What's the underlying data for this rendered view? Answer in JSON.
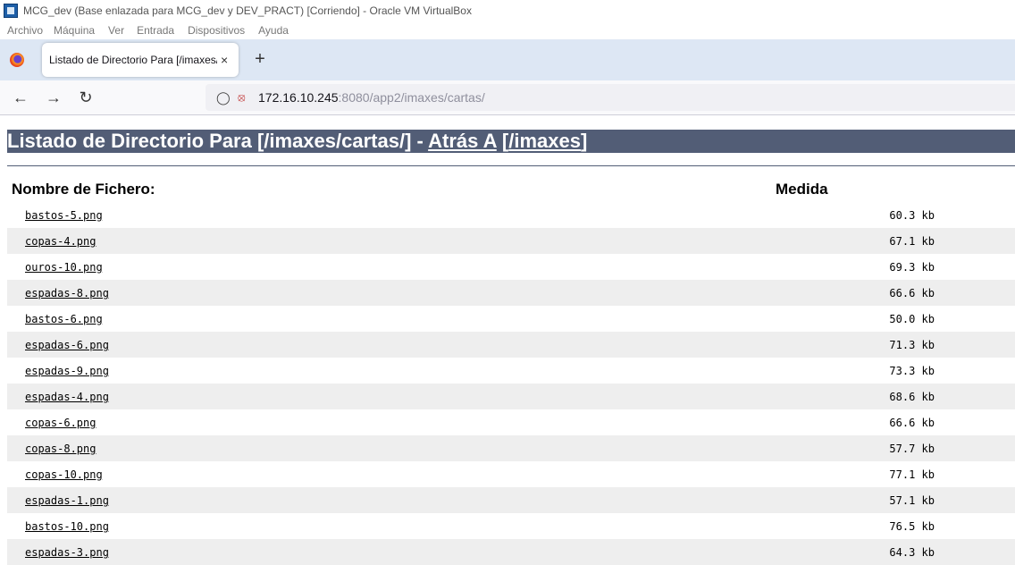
{
  "window": {
    "title": "MCG_dev (Base enlazada para MCG_dev y DEV_PRACT) [Corriendo] - Oracle VM VirtualBox",
    "menu": [
      "Archivo",
      "Máquina",
      "Ver",
      "Entrada",
      "Dispositivos",
      "Ayuda"
    ]
  },
  "browser": {
    "tab_title": "Listado de Directorio Para [/imaxes/",
    "tab_close": "×",
    "new_tab": "+",
    "url_host": "172.16.10.245",
    "url_rest": ":8080/app2/imaxes/cartas/",
    "icons": {
      "back": "back-arrow-icon",
      "forward": "forward-arrow-icon",
      "reload": "reload-icon",
      "shield": "tracking-shield-icon",
      "lock": "insecure-lock-icon"
    }
  },
  "page": {
    "heading_prefix": "Listado de Directorio Para [/imaxes/cartas/] - ",
    "heading_link": "Atrás A",
    "heading_space": " [",
    "heading_link2": "/imaxes",
    "heading_suffix": "]",
    "col_name": "Nombre de Fichero:",
    "col_size": "Medida",
    "header_color": "#525d76",
    "files": [
      {
        "name": "bastos-5.png",
        "size": "60.3 kb"
      },
      {
        "name": "copas-4.png",
        "size": "67.1 kb"
      },
      {
        "name": "ouros-10.png",
        "size": "69.3 kb"
      },
      {
        "name": "espadas-8.png",
        "size": "66.6 kb"
      },
      {
        "name": "bastos-6.png",
        "size": "50.0 kb"
      },
      {
        "name": "espadas-6.png",
        "size": "71.3 kb"
      },
      {
        "name": "espadas-9.png",
        "size": "73.3 kb"
      },
      {
        "name": "espadas-4.png",
        "size": "68.6 kb"
      },
      {
        "name": "copas-6.png",
        "size": "66.6 kb"
      },
      {
        "name": "copas-8.png",
        "size": "57.7 kb"
      },
      {
        "name": "copas-10.png",
        "size": "77.1 kb"
      },
      {
        "name": "espadas-1.png",
        "size": "57.1 kb"
      },
      {
        "name": "bastos-10.png",
        "size": "76.5 kb"
      },
      {
        "name": "espadas-3.png",
        "size": "64.3 kb"
      }
    ]
  }
}
